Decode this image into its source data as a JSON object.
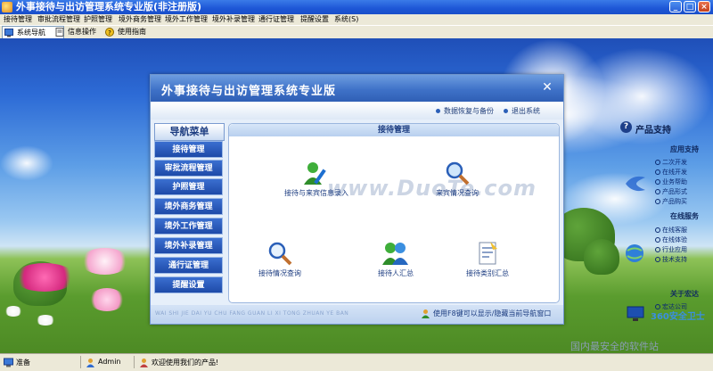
{
  "window": {
    "title": "外事接待与出访管理系统专业版(非注册版)",
    "minimize": "_",
    "maximize": "□",
    "close": "×"
  },
  "menu": [
    "接待管理",
    "审批流程管理",
    "护照管理",
    "境外商务管理",
    "境外工作管理",
    "境外补录管理",
    "通行证管理",
    "提醒设置",
    "系统(S)"
  ],
  "toolbar": {
    "nav": "系统导航",
    "info": "信息操作",
    "guide": "使用指南"
  },
  "panel": {
    "title": "外事接待与出访管理系统专业版",
    "close": "✕",
    "strip": {
      "backup": "数据恢复与备份",
      "exit": "退出系统"
    },
    "nav_header": "导航菜单",
    "nav_items": [
      "接待管理",
      "审批流程管理",
      "护照管理",
      "境外商务管理",
      "境外工作管理",
      "境外补录管理",
      "通行证管理",
      "提醒设置"
    ],
    "content_header": "接待管理",
    "tiles": {
      "entry": "接待与来宾信息录入",
      "guest_query": "来宾情况查询",
      "reception_query": "接待情况查询",
      "person_summary": "接待人汇总",
      "category_summary": "接待类别汇总"
    },
    "watermark": "www.DuoTe.com",
    "pinyin": "WAI SHI JIE DAI YU CHU FANG GUAN LI XI TONG ZHUAN YE BAN",
    "footer_tip": "使用F8键可以显示/隐藏当前导航窗口"
  },
  "support": {
    "title": "产品支持",
    "app_support": "应用支持",
    "app_links": [
      "二次开发",
      "在线开发",
      "业务帮助",
      "产品形式",
      "产品购买"
    ],
    "online": "在线服务",
    "online_links": [
      "在线客服",
      "在线体验",
      "行业应用",
      "技术支持"
    ],
    "about": "关于宏达",
    "about_links": [
      "宏达公司"
    ]
  },
  "badge": {
    "top": "360安全卫士",
    "bottom": "国内最安全的软件站"
  },
  "status": {
    "ready": "准备",
    "user": "Admin",
    "welcome": "欢迎使用我们的产品!"
  },
  "colors": {
    "title_blue": "#1d56d6",
    "nav_blue": "#1e4aa8",
    "panel_bg": "#e6effa"
  }
}
